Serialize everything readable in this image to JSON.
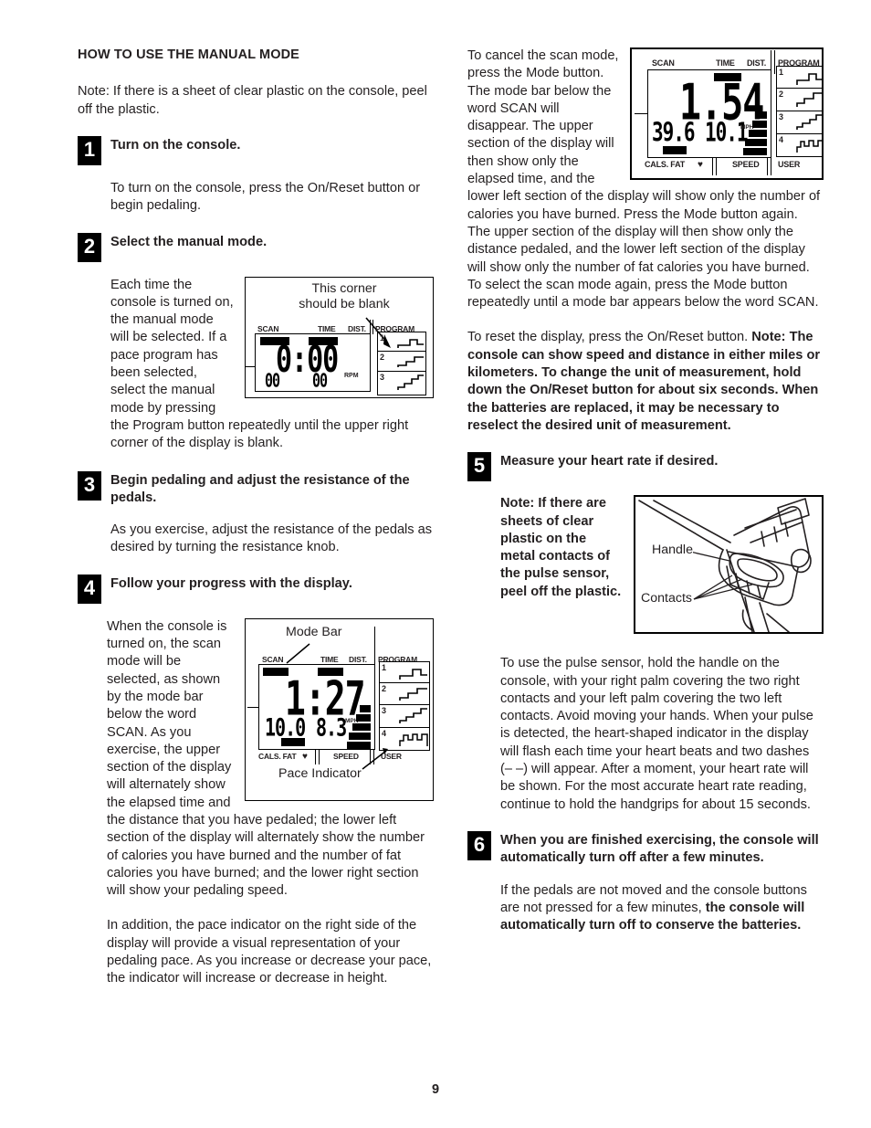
{
  "page": {
    "number": "9",
    "section_title": "HOW TO USE THE MANUAL MODE"
  },
  "left_column": {
    "intro_note": "Note: If there is a sheet of clear plastic on the console, peel off the plastic.",
    "steps": [
      {
        "number": "1",
        "heading": "Turn on the console.",
        "body": "To turn on the console, press the On/Reset button or begin pedaling."
      },
      {
        "number": "2",
        "heading": "Select the manual mode.",
        "body_wrap": "Each time the console is turned on, the manual mode will be selected. If a pace program has been selected, select the manual mode by pressing the Program button repeatedly until the upper right corner of the display is blank."
      },
      {
        "number": "3",
        "heading": "Begin pedaling and adjust the resistance of the pedals.",
        "body": "As you exercise, adjust the resistance of the pedals as desired by turning the resistance knob."
      },
      {
        "number": "4",
        "heading": "Follow your progress with the display.",
        "body_wrap": "When the console is turned on, the scan mode will be selected, as shown by the mode bar below the word SCAN. As you exercise, the upper section of the display will alternately show the elapsed time and the distance that you have pedaled; the lower left section of the display will alternately show the number of calories you have burned and the number of fat calories you have burned; and the lower right section will show your pedaling speed.",
        "body_extra": "In addition, the pace indicator on the right side of the display will provide a visual representation of your pedaling pace. As you increase or decrease your pace, the indicator will increase or decrease in height."
      }
    ]
  },
  "right_column": {
    "scan_paragraph": "To cancel the scan mode, press the Mode button. The mode bar below the word SCAN will disappear. The upper section of the display will then show only the elapsed time, and the lower left section of the display will show only the number of calories you have burned. Press the Mode button again. The upper section of the display will then show only the distance pedaled, and the lower left section of the display will show only the number of fat calories you have burned. To select the scan mode again, press the Mode button repeatedly until a mode bar appears below the word SCAN.",
    "reset_text": "To reset the display, press the On/Reset button. ",
    "reset_note_bold": "Note: The console can show speed and distance in either miles or kilometers. To change the unit of measurement, hold down the On/Reset button for about six seconds. When the batteries are replaced, it may be necessary to reselect the desired unit of measurement.",
    "steps": [
      {
        "number": "5",
        "heading": "Measure your heart rate if desired.",
        "note_bold": "Note: If there are sheets of clear plastic on the metal contacts of the pulse sensor, peel off the plastic.",
        "body": "To use the pulse sensor, hold the handle on the console, with your right palm covering the two right contacts and your left palm covering the two left contacts. Avoid moving your hands. When your pulse is detected, the heart-shaped indicator in the display will flash each time your heart beats and two dashes (– –) will appear. After a moment, your heart rate will be shown. For the most accurate heart rate reading, continue to hold the handgrips for about 15 seconds."
      },
      {
        "number": "6",
        "heading": "When you are finished exercising, the console will automatically turn off after a few minutes.",
        "body_plain": "If the pedals are not moved and the console buttons are not pressed for a few minutes, ",
        "body_bold": "the console will automatically turn off to conserve the batteries."
      }
    ]
  },
  "figures": {
    "console_top_right": {
      "name": "console-display-distance-mode",
      "labels_top": [
        "SCAN",
        "TIME",
        "DIST.",
        "PROGRAM"
      ],
      "labels_bottom": [
        "CALS. FAT",
        "SPEED",
        "USER"
      ],
      "upper_value": "1.54",
      "lower_left_value": "39.6",
      "lower_right_value": "10.1",
      "lower_right_unit": "MPH",
      "active_mode_top": "DIST.",
      "active_mode_bottom": "CALS. FAT",
      "heart_icon": "♥",
      "program_icons": [
        "1",
        "2",
        "3",
        "4"
      ]
    },
    "console_step2": {
      "name": "console-display-blank-corner",
      "callout": "This corner\nshould be blank",
      "callout_line1": "This corner",
      "callout_line2": "should be blank",
      "labels_top": [
        "SCAN",
        "TIME",
        "DIST.",
        "PROGRAM"
      ],
      "upper_value": "0:00",
      "lower_left_value": "00",
      "lower_right_value": "00",
      "lower_right_unit": "RPM",
      "program_icons": [
        "1",
        "2",
        "3"
      ]
    },
    "console_step4": {
      "name": "console-display-scan-mode",
      "callout_top": "Mode Bar",
      "callout_bottom": "Pace Indicator",
      "labels_top": [
        "SCAN",
        "TIME",
        "DIST.",
        "PROGRAM"
      ],
      "labels_bottom": [
        "CALS. FAT",
        "SPEED",
        "USER"
      ],
      "upper_value": "1:27",
      "lower_left_value": "10.0",
      "lower_right_value": "8.3",
      "lower_right_unit": "MPH",
      "active_mode_top": [
        "SCAN",
        "TIME"
      ],
      "active_mode_bottom": "CALS. FAT",
      "heart_icon": "♥",
      "program_icons": [
        "1",
        "2",
        "3",
        "4"
      ]
    },
    "handle_figure": {
      "name": "pulse-sensor-handle-illustration",
      "label_handle": "Handle",
      "label_contacts": "Contacts"
    }
  }
}
